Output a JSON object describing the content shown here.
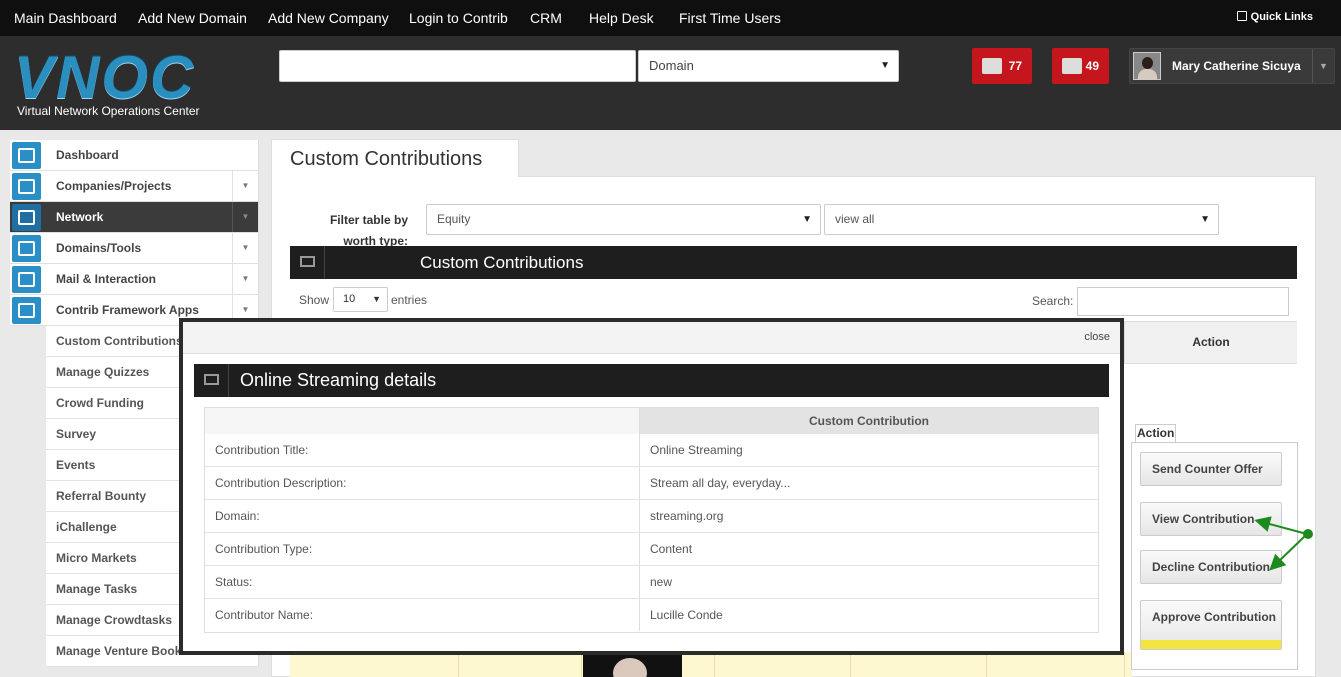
{
  "top_nav": {
    "items": [
      "Main Dashboard",
      "Add New Domain",
      "Add New Company",
      "Login to Contrib",
      "CRM",
      "Help Desk",
      "First Time Users"
    ],
    "quick_links": "Quick Links"
  },
  "header": {
    "logo_text": "VNOC",
    "logo_subtitle": "Virtual Network Operations Center",
    "search_value": "",
    "domain_select": "Domain",
    "notifications": [
      {
        "icon": "tickets-icon",
        "count": "77"
      },
      {
        "icon": "mail-icon",
        "count": "49"
      }
    ],
    "user_name": "Mary Catherine Sicuya"
  },
  "sidebar": {
    "items": [
      {
        "label": "Dashboard",
        "icon": "chart-icon",
        "arrow": false
      },
      {
        "label": "Companies/Projects",
        "icon": "building-icon",
        "arrow": true
      },
      {
        "label": "Network",
        "icon": "network-icon",
        "arrow": true,
        "active": true
      },
      {
        "label": "Domains/Tools",
        "icon": "gear-icon",
        "arrow": true
      },
      {
        "label": "Mail & Interaction",
        "icon": "envelope-icon",
        "arrow": true
      },
      {
        "label": "Contrib Framework Apps",
        "icon": "puzzle-icon",
        "arrow": true
      }
    ],
    "sub_items": [
      "Custom Contributions",
      "Manage Quizzes",
      "Crowd Funding",
      "Survey",
      "Events",
      "Referral Bounty",
      "iChallenge",
      "Micro Markets",
      "Manage Tasks",
      "Manage Crowdtasks",
      "Manage Venture Book"
    ]
  },
  "main": {
    "tab_title": "Custom Contributions",
    "filter_label": "Filter table by worth type:",
    "worth_type": "Equity",
    "status_filter": "view all",
    "grid_title": "Custom Contributions",
    "show_label": "Show",
    "page_size": "10",
    "entries_label": "entries",
    "search_label": "Search:",
    "action_header": "Action"
  },
  "action_menu": {
    "tag": "Action",
    "buttons": [
      "Send Counter Offer",
      "View Contribution",
      "Decline Contribution",
      "Approve Contribution"
    ]
  },
  "modal": {
    "close_label": "close",
    "title": "Online Streaming details",
    "column_header": "Custom Contribution",
    "rows": [
      {
        "label": "Contribution Title:",
        "value": "Online Streaming"
      },
      {
        "label": "Contribution Description:",
        "value": "Stream all day, everyday..."
      },
      {
        "label": "Domain:",
        "value": "streaming.org"
      },
      {
        "label": "Contribution Type:",
        "value": "Content"
      },
      {
        "label": "Status:",
        "value": "new"
      },
      {
        "label": "Contributor Name:",
        "value": "Lucille Conde"
      }
    ]
  },
  "colors": {
    "nav_bg": "#0f0f0f",
    "header_bg": "#2d2d2d",
    "accent_blue": "#2a8fc6",
    "alert_red": "#c4161c",
    "annotation_green": "#1e8a1e"
  }
}
